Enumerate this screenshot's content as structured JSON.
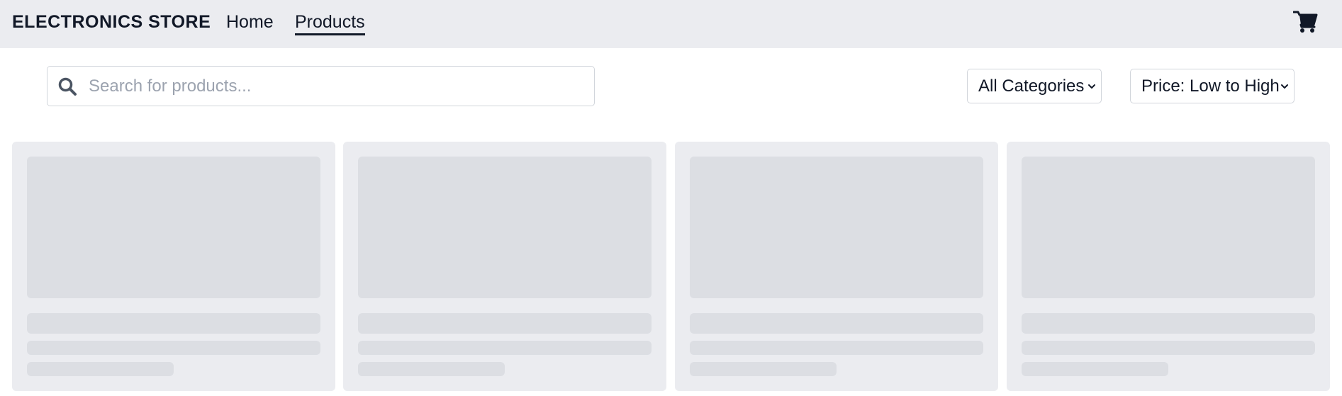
{
  "header": {
    "brand": "ELECTRONICS STORE",
    "nav": [
      {
        "label": "Home",
        "active": false
      },
      {
        "label": "Products",
        "active": true
      }
    ],
    "cart_icon": "shopping-cart-icon"
  },
  "toolbar": {
    "search": {
      "placeholder": "Search for products...",
      "value": "",
      "icon": "search-icon"
    },
    "category_select": {
      "selected": "All Categories",
      "icon": "chevron-down-icon"
    },
    "sort_select": {
      "selected": "Price: Low to High",
      "icon": "chevron-down-icon"
    }
  },
  "products": {
    "state": "loading",
    "skeleton_cards": 4
  },
  "colors": {
    "header_bg": "#ebecf0",
    "card_bg": "#ebecf0",
    "skeleton": "#dcdee3",
    "text": "#111827",
    "placeholder": "#9ca3af",
    "border": "#d1d5db"
  }
}
